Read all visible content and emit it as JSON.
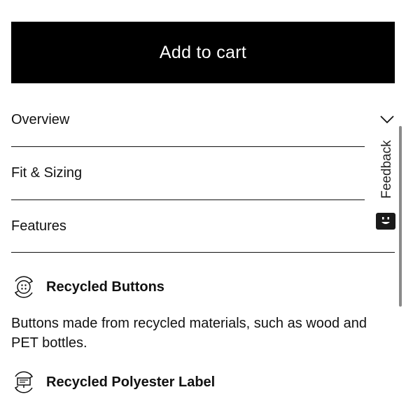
{
  "cta": {
    "add_to_cart_label": "Add to cart"
  },
  "accordion": {
    "items": [
      {
        "label": "Overview"
      },
      {
        "label": "Fit & Sizing"
      },
      {
        "label": "Features"
      }
    ]
  },
  "features": [
    {
      "title": "Recycled Buttons",
      "description": "Buttons made from recycled materials, such as wood and PET bottles.",
      "icon": "recycled-buttons-icon"
    },
    {
      "title": "Recycled Polyester Label",
      "icon": "recycled-label-icon"
    }
  ],
  "feedback": {
    "label": "Feedback",
    "icon": "feedback-face-icon"
  },
  "colors": {
    "primary": "#000000",
    "text": "#111111",
    "background": "#ffffff"
  }
}
